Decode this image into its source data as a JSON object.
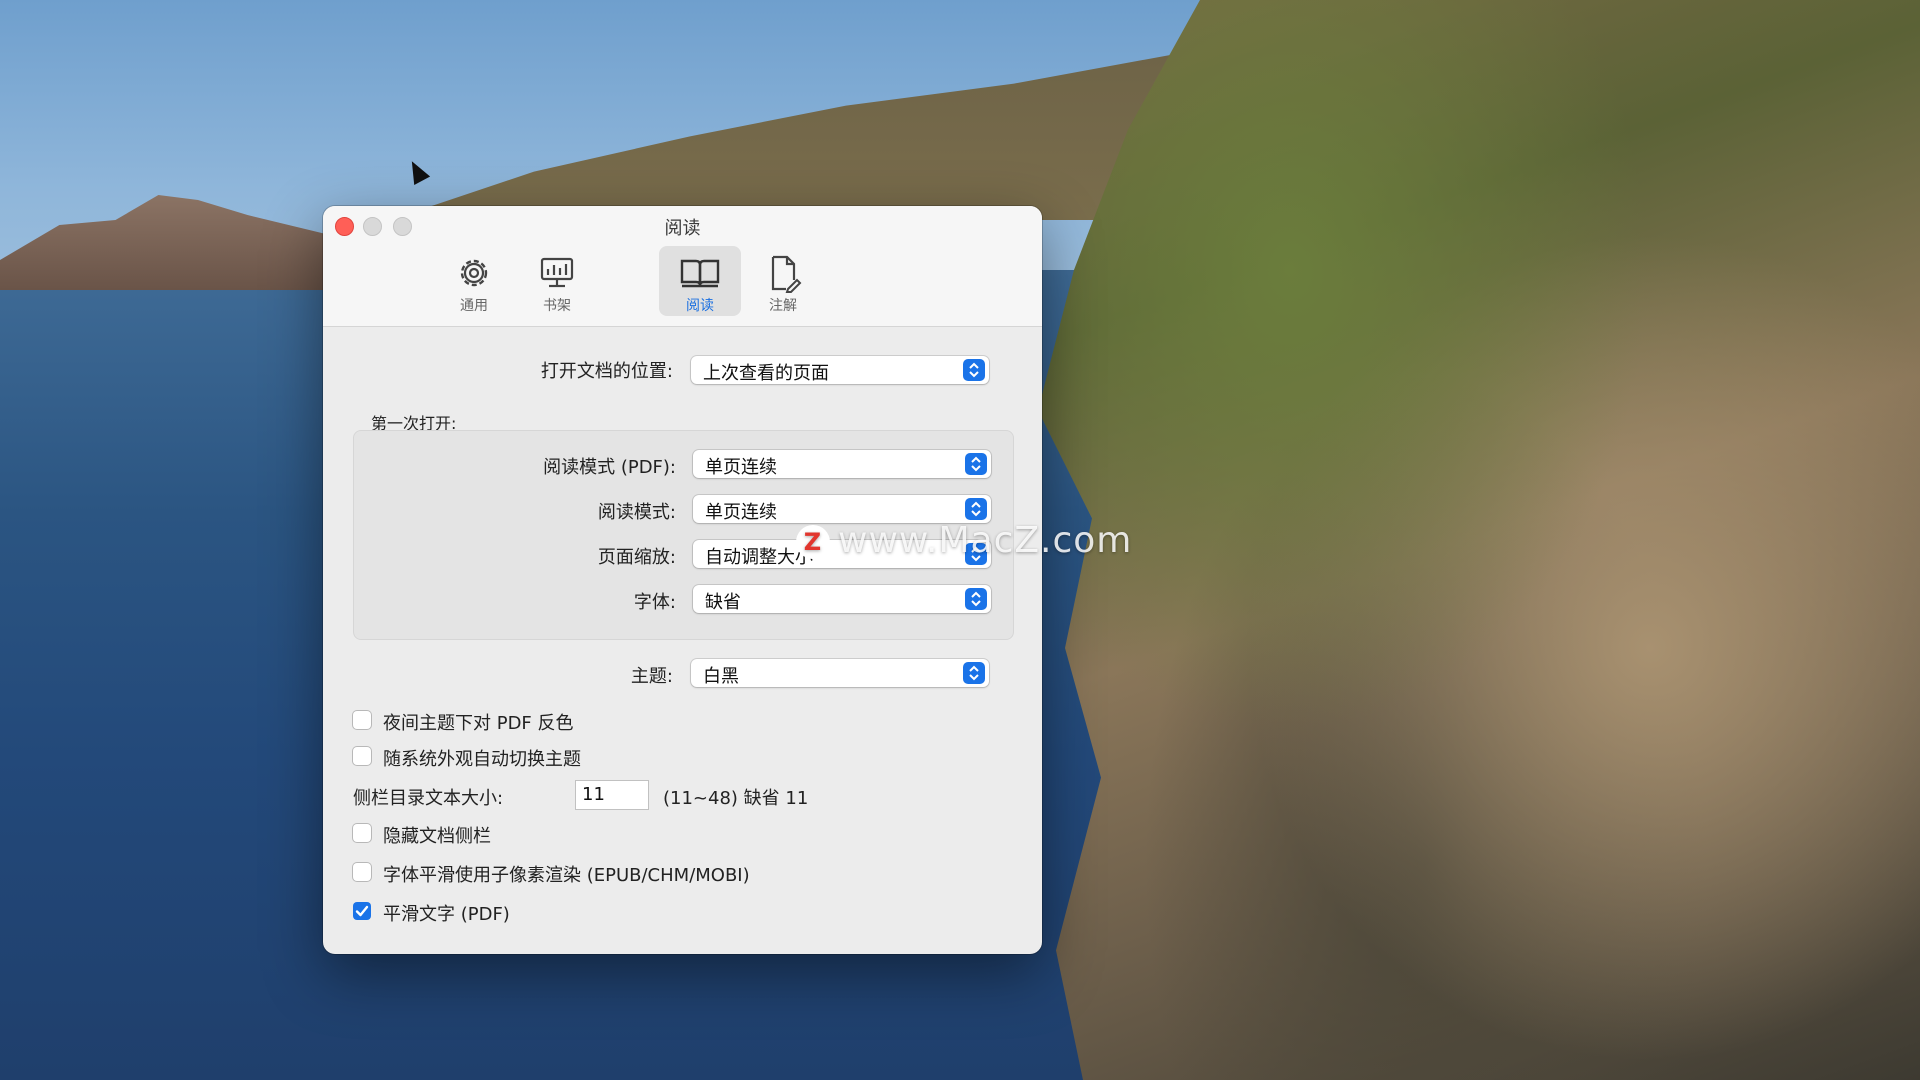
{
  "window": {
    "title": "阅读"
  },
  "toolbar": {
    "tabs": [
      {
        "label": "通用",
        "icon": "gear-icon"
      },
      {
        "label": "书架",
        "icon": "monitor-icon"
      },
      {
        "label": "阅读",
        "icon": "book-icon",
        "selected": true
      },
      {
        "label": "注解",
        "icon": "annotate-doc-icon"
      }
    ]
  },
  "settings": {
    "open_position": {
      "label": "打开文档的位置:",
      "value": "上次查看的页面"
    },
    "first_open": {
      "group_label": "第一次打开:",
      "read_mode_pdf": {
        "label": "阅读模式 (PDF):",
        "value": "单页连续"
      },
      "read_mode": {
        "label": "阅读模式:",
        "value": "单页连续"
      },
      "page_zoom": {
        "label": "页面缩放:",
        "value": "自动调整大小"
      },
      "font": {
        "label": "字体:",
        "value": "缺省"
      }
    },
    "theme": {
      "label": "主题:",
      "value": "白黑"
    },
    "invert_pdf_night": {
      "label": "夜间主题下对 PDF 反色",
      "checked": false
    },
    "auto_switch_theme": {
      "label": "随系统外观自动切换主题",
      "checked": false
    },
    "sidebar_text_size": {
      "label": "侧栏目录文本大小:",
      "value": "11",
      "hint": "(11~48) 缺省 11"
    },
    "hide_sidebar": {
      "label": "隐藏文档侧栏",
      "checked": false
    },
    "subpixel_render": {
      "label": "字体平滑使用子像素渲染 (EPUB/CHM/MOBI)",
      "checked": false
    },
    "smooth_text_pdf": {
      "label": "平滑文字 (PDF)",
      "checked": true
    }
  },
  "watermark": {
    "text": "www.MacZ.com",
    "logo": "Z"
  },
  "colors": {
    "accent": "#1a73e8",
    "close": "#ff5f57"
  }
}
